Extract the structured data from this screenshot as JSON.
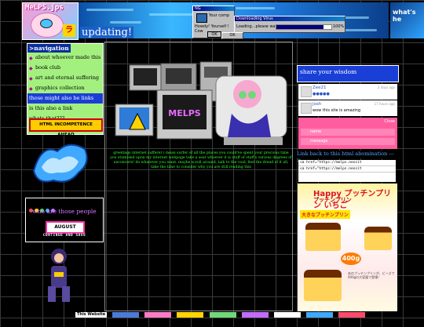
{
  "header": {
    "logo_text": "MeLPS.jps",
    "logo_badge": "ラ",
    "updating_label": "updating!",
    "whats_label": "what's he"
  },
  "windows": {
    "small_window": {
      "title": "NG",
      "line1": "Your comp",
      "line2": "Howdy! Yourself ! Cow",
      "ok_label": "OK"
    },
    "download_window": {
      "title": "Downloading Virus",
      "label": "Loading...please wait",
      "progress": 0.85,
      "percent_text": "100%"
    },
    "ok_button": "OK"
  },
  "nav": {
    "title": ">navigation",
    "items": [
      {
        "label": "about whoever made this",
        "style": "bullet"
      },
      {
        "label": "book club",
        "style": "bullet"
      },
      {
        "label": "art and eternal suffering",
        "style": "bullet"
      },
      {
        "label": "graphics collection",
        "style": "bullet"
      },
      {
        "label": "those might also be links",
        "style": "blue"
      },
      {
        "label": "is this also a link",
        "style": "plain"
      },
      {
        "label": "whats that???",
        "style": "plain"
      }
    ],
    "warning": "HTML INCOMPETENCE AHEAD"
  },
  "left": {
    "who_title": "who are those people",
    "who_button": "AUGUST",
    "continue_save": "CONTINUE AND SAVE"
  },
  "main": {
    "sticker_text": "MELPS",
    "greeting": "greetings internet sufferer i mean surfer of all the places you could've spent your precious time you stumbled upon my internet webpage take a seat whoever it is stuff of stuff's various degrees of unconcern! do whatever you want. maybe scroll around, talk to the void, feel the dread of it all, take the time to consider why you are still reading this"
  },
  "right": {
    "share_title": "share your wisdom",
    "share_sub": "...",
    "comments": [
      {
        "name": "Zee21",
        "time": "2 days ago",
        "body": "●●●●●"
      },
      {
        "name": "josh",
        "time": "17 hours ago",
        "body": "wow this site is amazing"
      }
    ],
    "chat": {
      "header": "Close",
      "name_placeholder": "name",
      "message_placeholder": "message"
    },
    "link_back": "Link back to this html abomination --->",
    "code_lines": [
      "<a href=\"https://melps.neocit",
      "<a href=\"https://melps.neocit"
    ],
    "ad": {
      "title": "Happy プッチンプリン いちご",
      "subtitle": "プッチンプリン",
      "sale_text": "大きなプッチンプリン",
      "price": "400g",
      "caption": "あのプッチンプリンが、ビーズで400gの大容量で登場！"
    }
  },
  "taskbar": {
    "items": [
      "This Website"
    ]
  },
  "colors": {
    "nav_bg": "#a3f07f",
    "nav_head": "#0a2f9a",
    "share_bg": "#1a3fd6",
    "chat_bg": "#ff5d9e",
    "greeting": "#2bff2b",
    "warning_bg": "#ffcc00"
  }
}
